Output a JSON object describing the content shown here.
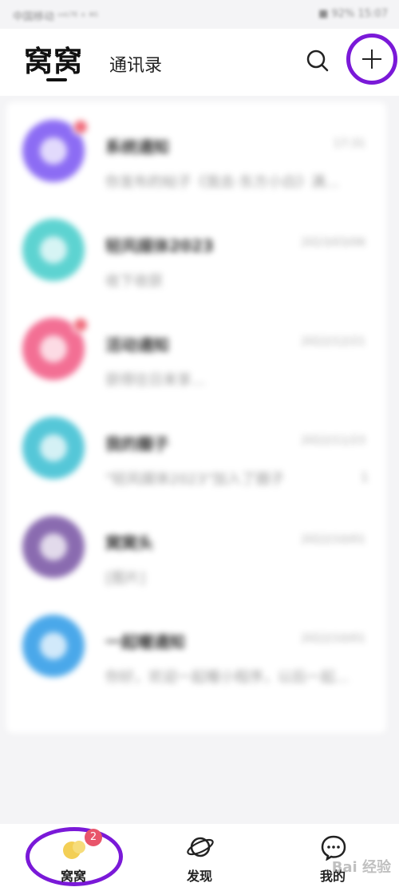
{
  "status_bar": {
    "left_text": "中国移动 ᵛᵒᴸᵀᴱ ᵒ ⁴ᴳ",
    "right_text": "■ 92% 15:07"
  },
  "header": {
    "active_tab": "窝窝",
    "contacts_tab": "通讯录"
  },
  "conversations": [
    {
      "title": "系统通知",
      "time": "17:31",
      "preview": "你发布的帖子《我去·东方小白》满...",
      "avatar_color": "#8c6cf4",
      "unread_dot": true,
      "count": ""
    },
    {
      "title": "轻风媒体2023",
      "time": "2023/03/06",
      "preview": "收下收获",
      "avatar_color": "#5dd3d1",
      "unread_dot": false,
      "count": ""
    },
    {
      "title": "活动通知",
      "time": "2022/12/21",
      "preview": "获得往日来享...",
      "avatar_color": "#f36f94",
      "unread_dot": true,
      "count": ""
    },
    {
      "title": "我的圈子",
      "time": "2022/11/23",
      "preview": "\"轻风媒体2023\"加入了圈子",
      "avatar_color": "#55c7d8",
      "unread_dot": false,
      "count": "1"
    },
    {
      "title": "窝窝头",
      "time": "2022/10/01",
      "preview": "[图片]",
      "avatar_color": "#8a6bb0",
      "unread_dot": false,
      "count": ""
    },
    {
      "title": "一起喔通知",
      "time": "2022/10/01",
      "preview": "你好，欢迎一起喔小程序，以后一起...",
      "avatar_color": "#4aa8ea",
      "unread_dot": false,
      "count": ""
    }
  ],
  "bottom_nav": [
    {
      "label": "窝窝",
      "badge": "2",
      "icon": "bubble-icon"
    },
    {
      "label": "发现",
      "badge": "",
      "icon": "planet-icon"
    },
    {
      "label": "我的",
      "badge": "",
      "icon": "chat-face-icon"
    }
  ],
  "watermark": "Bai 经验",
  "colors": {
    "highlight": "#7a19d8",
    "badge": "#e8556a",
    "bubble": "#f3cf55"
  }
}
